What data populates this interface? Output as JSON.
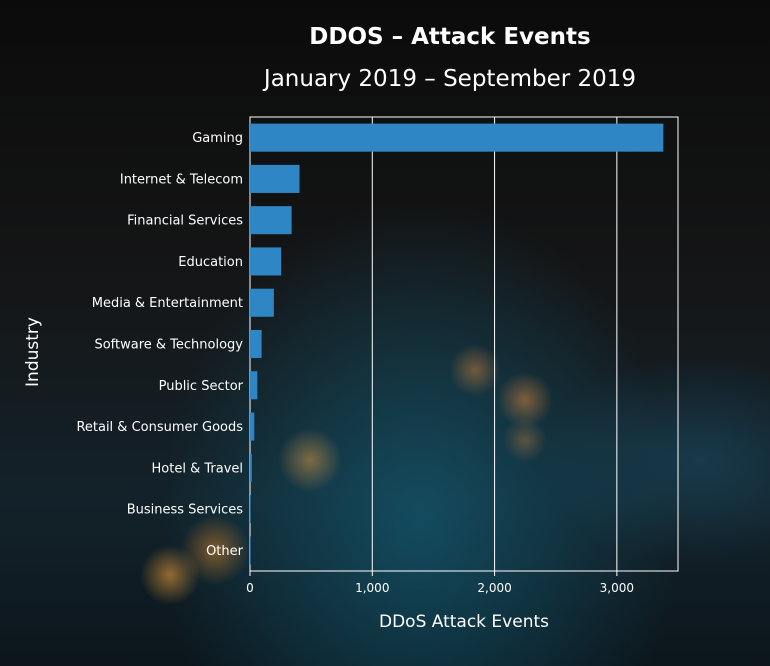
{
  "chart_data": {
    "type": "bar",
    "orientation": "horizontal",
    "title": "DDOS – Attack Events",
    "subtitle": "January 2019 – September 2019",
    "xlabel": "DDoS Attack Events",
    "ylabel": "Industry",
    "categories": [
      "Gaming",
      "Internet & Telecom",
      "Financial Services",
      "Education",
      "Media & Entertainment",
      "Software & Technology",
      "Public Sector",
      "Retail & Consumer Goods",
      "Hotel & Travel",
      "Business Services",
      "Other"
    ],
    "values": [
      3380,
      405,
      340,
      255,
      195,
      95,
      60,
      35,
      15,
      5,
      2
    ],
    "xlim": [
      0,
      3500
    ],
    "xticks": [
      0,
      1000,
      2000,
      3000
    ],
    "xtick_labels": [
      "0",
      "1,000",
      "2,000",
      "3,000"
    ],
    "grid": true,
    "bar_color": "#2f86c5"
  }
}
